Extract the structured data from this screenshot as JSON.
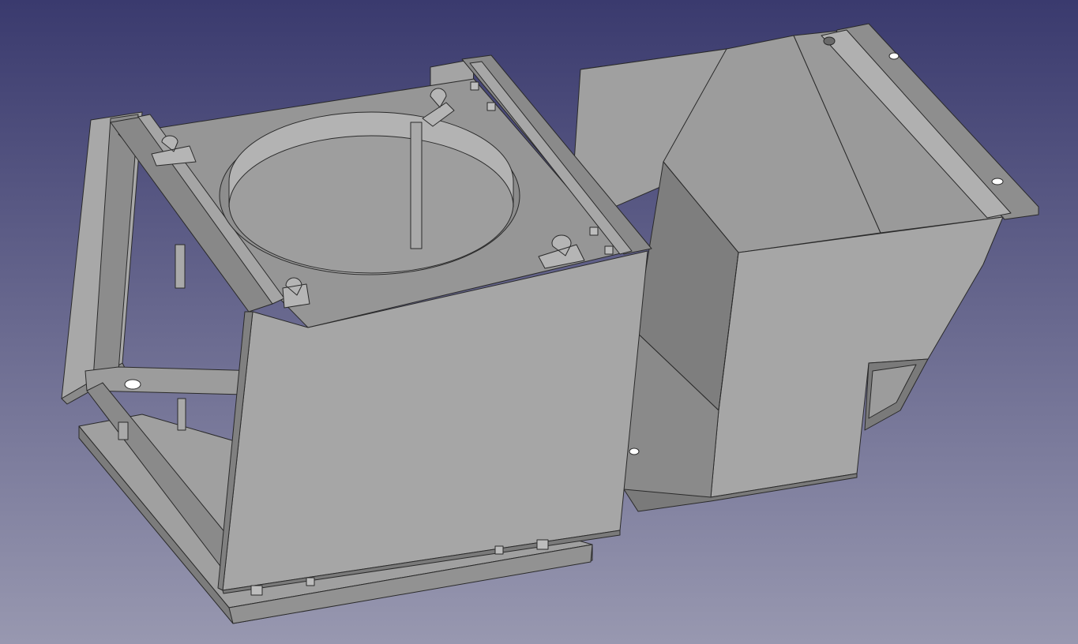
{
  "viewport": {
    "background_top": "#3a3a6e",
    "background_bottom": "#9898b0"
  },
  "model": {
    "face_light": "#a6a6a6",
    "face_mid": "#9a9a9a",
    "face_dark": "#868686",
    "face_shadow": "#707070",
    "edge": "#2a2a2a"
  }
}
